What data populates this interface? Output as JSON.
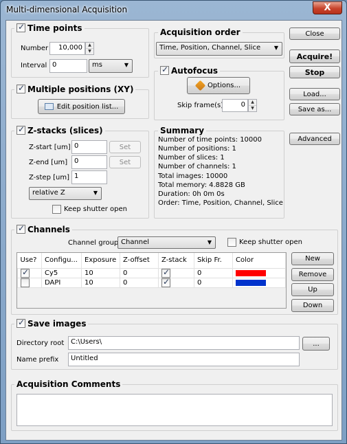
{
  "window": {
    "title": "Multi-dimensional Acquisition",
    "close_glyph": "X"
  },
  "time_points": {
    "title": "Time points",
    "enabled": true,
    "number_label": "Number",
    "number_value": "10,000",
    "interval_label": "Interval",
    "interval_value": "0",
    "interval_unit": "ms"
  },
  "multiple_positions": {
    "title": "Multiple positions (XY)",
    "enabled": true,
    "edit_button": "Edit position list..."
  },
  "z_stacks": {
    "title": "Z-stacks (slices)",
    "enabled": true,
    "start_label": "Z-start [um]",
    "start_value": "0",
    "start_set": "Set",
    "end_label": "Z-end [um]",
    "end_value": "0",
    "end_set": "Set",
    "step_label": "Z-step [um]",
    "step_value": "1",
    "mode": "relative Z",
    "keep_shutter_label": "Keep shutter open",
    "keep_shutter": false
  },
  "acquisition_order": {
    "title": "Acquisition order",
    "value": "Time, Position, Channel, Slice"
  },
  "autofocus": {
    "title": "Autofocus",
    "enabled": true,
    "options_button": "Options...",
    "skip_label": "Skip frame(s):",
    "skip_value": "0"
  },
  "summary": {
    "title": "Summary",
    "lines": [
      "Number of time points: 10000",
      "Number of positions: 1",
      "Number of slices: 1",
      "Number of channels: 1",
      "Total images: 10000",
      "Total memory: 4.8828 GB",
      "Duration: 0h 0m 0s",
      "Order: Time, Position, Channel, Slice"
    ]
  },
  "side_buttons": {
    "close": "Close",
    "acquire": "Acquire!",
    "stop": "Stop",
    "load": "Load...",
    "save_as": "Save as...",
    "advanced": "Advanced"
  },
  "channels": {
    "title": "Channels",
    "enabled": true,
    "group_label": "Channel group:",
    "group_value": "Channel",
    "keep_shutter_label": "Keep shutter open",
    "keep_shutter": false,
    "columns": [
      "Use?",
      "Configu...",
      "Exposure",
      "Z-offset",
      "Z-stack",
      "Skip Fr.",
      "Color"
    ],
    "rows": [
      {
        "use": true,
        "config": "Cy5",
        "exposure": "10",
        "zoffset": "0",
        "zstack": true,
        "skip": "0",
        "color": "#ff0000"
      },
      {
        "use": false,
        "config": "DAPI",
        "exposure": "10",
        "zoffset": "0",
        "zstack": true,
        "skip": "0",
        "color": "#0033cc"
      }
    ],
    "buttons": {
      "new": "New",
      "remove": "Remove",
      "up": "Up",
      "down": "Down"
    }
  },
  "save_images": {
    "title": "Save images",
    "enabled": true,
    "dir_label": "Directory root",
    "dir_value": "C:\\Users\\",
    "browse": "...",
    "prefix_label": "Name prefix",
    "prefix_value": "Untitled"
  },
  "comments": {
    "title": "Acquisition Comments",
    "value": ""
  }
}
